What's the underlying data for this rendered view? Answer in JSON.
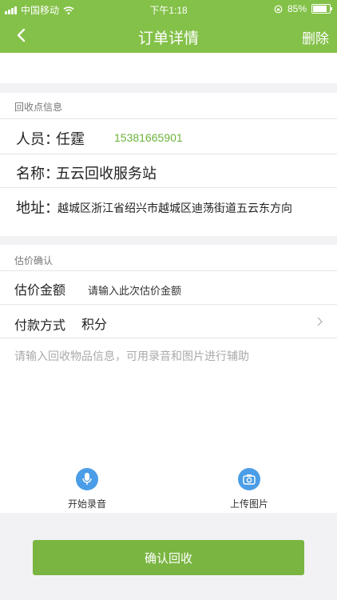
{
  "status_bar": {
    "carrier": "中国移动",
    "time": "下午1:18",
    "battery": "85%",
    "battery_level": 0.85
  },
  "nav": {
    "title": "订单详情",
    "delete_label": "删除"
  },
  "recycle_point": {
    "section_title": "回收点信息",
    "person_label": "人员：",
    "person_name": "任霆",
    "phone": "15381665901",
    "name_label": "名称：",
    "name_value": "五云回收服务站",
    "address_label": "地址：",
    "address_value": "越城区浙江省绍兴市越城区迪荡街道五云东方向"
  },
  "estimate": {
    "section_title": "估价确认",
    "amount_label": "估价金额",
    "amount_placeholder": "请输入此次估价金额",
    "payment_label": "付款方式",
    "payment_value": "积分",
    "info_placeholder": "请输入回收物品信息，可用录音和图片进行辅助"
  },
  "tools": {
    "record_label": "开始录音",
    "upload_label": "上传图片"
  },
  "confirm_label": "确认回收",
  "colors": {
    "brand_green": "#84c149",
    "button_green": "#7ab541",
    "phone_green": "#6bb33b",
    "icon_blue": "#4a9de6"
  }
}
